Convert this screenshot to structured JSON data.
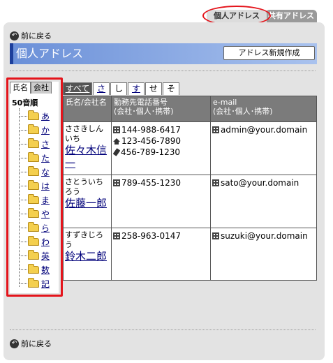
{
  "top_tabs": {
    "personal": "個人アドレス",
    "shared": "共有アドレス"
  },
  "back_label": "前に戻る",
  "page_title": "個人アドレス",
  "new_button": "アドレス新規作成",
  "tree": {
    "tab_name": "氏名",
    "tab_company": "会社",
    "heading": "50音順",
    "items": [
      "あ",
      "か",
      "さ",
      "た",
      "な",
      "は",
      "ま",
      "や",
      "ら",
      "わ",
      "英",
      "数",
      "記"
    ]
  },
  "kana_filter": [
    "すべて",
    "さ",
    "し",
    "す",
    "せ",
    "そ"
  ],
  "table": {
    "headers": {
      "name": "氏名/会社名",
      "tel": "勤務先電話番号\n(会社･個人･携帯)",
      "email": "e-mail\n(会社･個人･携帯)"
    },
    "rows": [
      {
        "kana": "ささきしんいち",
        "name": "佐々木信一",
        "tel_office": "144-988-6417",
        "tel_home": "123-456-7890",
        "tel_mobile": "456-789-1230",
        "email": "admin@your.domain"
      },
      {
        "kana": "さとういちろう",
        "name": "佐藤一郎",
        "tel_office": "789-455-1230",
        "email": "sato@your.domain"
      },
      {
        "kana": "すずきじろう",
        "name": "鈴木二郎",
        "tel_office": "258-963-0147",
        "email": "suzuki@your.domain"
      }
    ]
  },
  "colors": {
    "highlight": "#e4141b",
    "title_bar": "#6b90d8",
    "panel": "#e3e3e3",
    "header": "#7b7b7b"
  },
  "icons": [
    "back-arrow-icon",
    "folder-icon",
    "office-building-icon",
    "home-icon",
    "mobile-phone-icon"
  ]
}
